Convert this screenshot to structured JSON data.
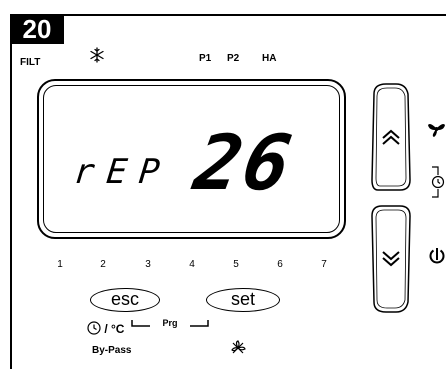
{
  "figure": {
    "number": "20"
  },
  "indicators": {
    "filt": "FILT",
    "p1": "P1",
    "p2": "P2",
    "ha": "HA",
    "snowflake_icon": "snowflake-icon"
  },
  "display": {
    "message": "rEP",
    "value": "26"
  },
  "position_numbers": [
    "1",
    "2",
    "3",
    "4",
    "5",
    "6",
    "7"
  ],
  "buttons": {
    "esc_label": "esc",
    "set_label": "set",
    "up_icon": "double-chevron-up-icon",
    "down_icon": "double-chevron-down-icon"
  },
  "prg_label": "Prg",
  "clock_unit_label": "/ °C",
  "bypass_label": "By-Pass",
  "side_icons": [
    "fan-icon",
    "clock-bracket-icon",
    "power-icon",
    "crossed-fan-icon"
  ]
}
